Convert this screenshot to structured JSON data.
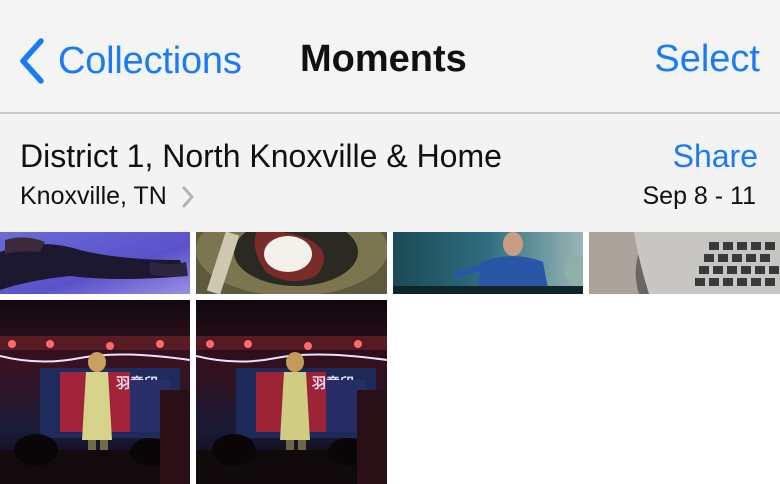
{
  "nav": {
    "back_label": "Collections",
    "title": "Moments",
    "select_label": "Select"
  },
  "moment": {
    "title": "District 1, North Knoxville & Home",
    "location": "Knoxville, TN",
    "dates": "Sep 8 - 11",
    "share_label": "Share"
  },
  "colors": {
    "accent": "#1a7cf5",
    "nav_bg": "#f4f4f5",
    "header_bg": "#f3f3f4"
  },
  "photos": [
    {
      "name": "photo-person-lying"
    },
    {
      "name": "photo-food-bowl"
    },
    {
      "name": "photo-presenter-stage"
    },
    {
      "name": "photo-laptop-keyboard"
    },
    {
      "name": "photo-singer-stage-1"
    },
    {
      "name": "photo-singer-stage-2"
    }
  ]
}
